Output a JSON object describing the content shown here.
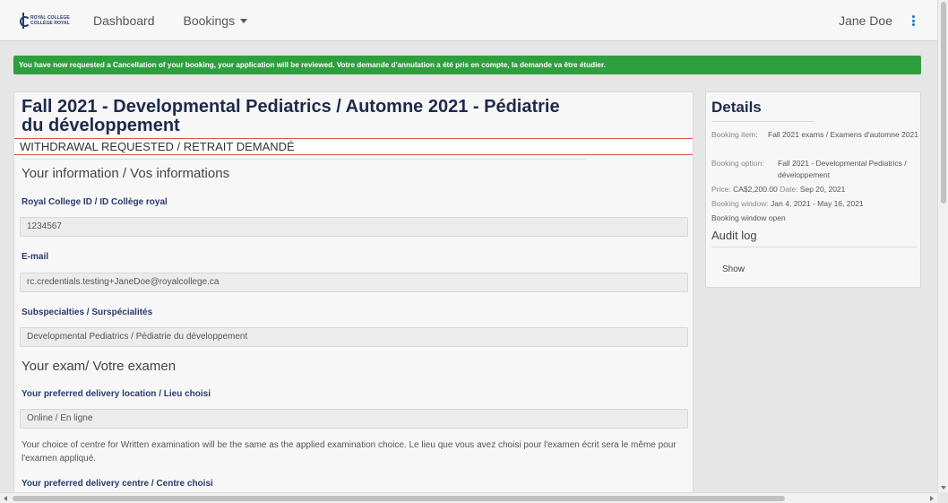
{
  "navbar": {
    "logo_line1": "ROYAL COLLEGE",
    "logo_line2": "COLLÈGE ROYAL",
    "dashboard": "Dashboard",
    "bookings": "Bookings",
    "user": "Jane Doe"
  },
  "alert": {
    "text": "You have now requested a Cancellation of your booking, your application will be reviewed. Votre demande d'annulation a été pris en compte, la demande va être étudier.",
    "color": "#2f9e3f"
  },
  "main": {
    "title": "Fall 2021 - Developmental Pediatrics / Automne 2021 - Pédiatrie du développement",
    "status": "WITHDRAWAL REQUESTED / RETRAIT DEMANDÉ",
    "info_heading": "Your information / Vos informations",
    "rc_id_label": "Royal College ID / ID Collège royal",
    "rc_id_value": "1234567",
    "email_label": "E-mail",
    "email_value": "rc.credentials.testing+JaneDoe@royalcollege.ca",
    "subspecialties_label": "Subspecialties / Surspécialités",
    "subspecialties_value": "Developmental Pediatrics / Pédiatrie du développement",
    "exam_heading": "Your exam/ Votre examen",
    "location_label": "Your preferred delivery location / Lieu choisi",
    "location_value": "Online / En ligne",
    "centre_note": "Your choice of centre for Written examination will be the same as the applied examination choice. Le lieu que vous avez choisi pour l'examen écrit sera le même pour l'examen appliqué.",
    "centre_label": "Your preferred delivery centre / Centre choisi"
  },
  "details": {
    "title": "Details",
    "booking_item_key": "Booking item:",
    "booking_item_value": "Fall 2021 exams / Examens d'automne 2021",
    "booking_option_key": "Booking option:",
    "booking_option_value": "Fall 2021 - Developmental Pediatrics / développement",
    "price_key": "Price:",
    "price_value": "CA$2,200.00",
    "date_key": "Date:",
    "date_value": "Sep 20, 2021",
    "window_key": "Booking window:",
    "window_value": "Jan 4, 2021 - May 16, 2021",
    "window_status": "Booking window open",
    "audit_title": "Audit log",
    "show": "Show"
  }
}
